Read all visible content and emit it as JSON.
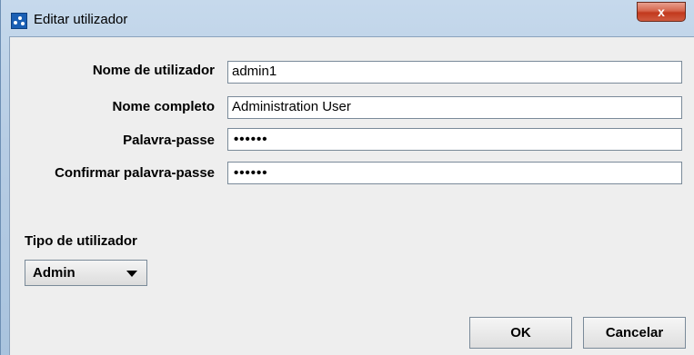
{
  "window": {
    "title": "Editar utilizador",
    "close_symbol": "x"
  },
  "form": {
    "fields": [
      {
        "label": "Nome de utilizador",
        "value": "admin1",
        "type": "text"
      },
      {
        "label": "Nome completo",
        "value": "Administration User",
        "type": "text"
      },
      {
        "label": "Palavra-passe",
        "value": "••••••",
        "type": "password"
      },
      {
        "label": "Confirmar palavra-passe",
        "value": "••••••",
        "type": "password"
      }
    ]
  },
  "user_type": {
    "label": "Tipo de utilizador",
    "selected": "Admin"
  },
  "buttons": {
    "ok": "OK",
    "cancel": "Cancelar"
  },
  "icons": {
    "app": "java-app-icon",
    "close": "close-icon",
    "dropdown": "chevron-down-icon"
  },
  "colors": {
    "titlebar": "#b7cde4",
    "close_button": "#c2391d",
    "dialog_background": "#eeeeee"
  }
}
